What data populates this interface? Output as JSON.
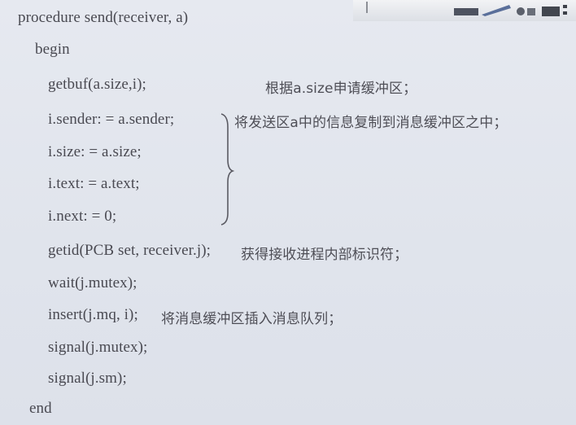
{
  "code_lines": [
    "procedure send(receiver, a)",
    "begin",
    "getbuf(a.size,i);",
    "i.sender:  =  a.sender;",
    "i.size:  =  a.size;",
    "i.text:  =  a.text;",
    "i.next:  =  0;",
    "getid(PCB set, receiver.j);",
    "wait(j.mutex);",
    "insert(j.mq, i);",
    "signal(j.mutex);",
    "signal(j.sm);",
    "end"
  ],
  "comments": {
    "getbuf": "根据a.size申请缓冲区；",
    "copy": "将发送区a中的信息复制到消息缓冲区之中；",
    "getid": "获得接收进程内部标识符；",
    "insert": "将消息缓冲区插入消息队列；"
  },
  "colors": {
    "background": "#e2e6ee",
    "text": "#4a4a52"
  }
}
